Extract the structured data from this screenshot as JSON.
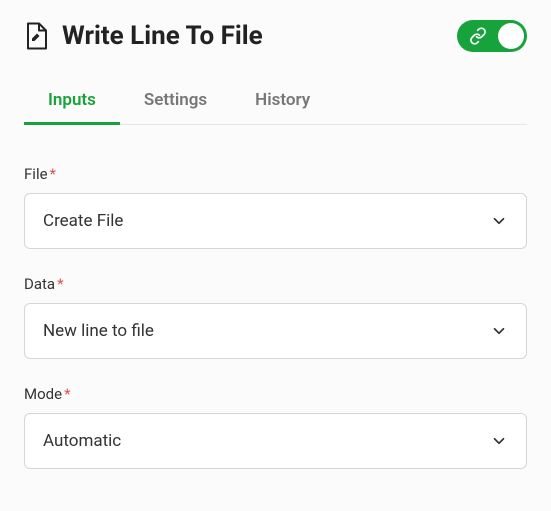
{
  "header": {
    "title": "Write Line To File",
    "toggle_on": true
  },
  "tabs": [
    {
      "id": "inputs",
      "label": "Inputs",
      "active": true
    },
    {
      "id": "settings",
      "label": "Settings",
      "active": false
    },
    {
      "id": "history",
      "label": "History",
      "active": false
    }
  ],
  "form": {
    "file": {
      "label": "File",
      "required_mark": "*",
      "value": "Create File"
    },
    "data": {
      "label": "Data",
      "required_mark": "*",
      "value": "New line to file"
    },
    "mode": {
      "label": "Mode",
      "required_mark": "*",
      "value": "Automatic"
    }
  }
}
